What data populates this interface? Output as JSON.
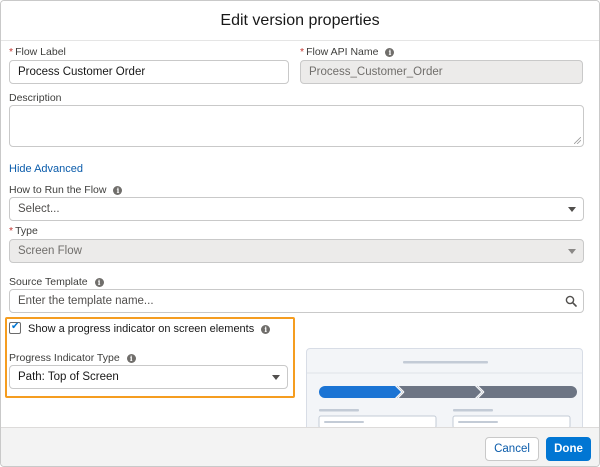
{
  "modal": {
    "title": "Edit version properties"
  },
  "fields": {
    "flow_label": {
      "label": "Flow Label",
      "value": "Process Customer Order",
      "required": "*"
    },
    "flow_api_name": {
      "label": "Flow API Name",
      "value": "Process_Customer_Order",
      "required": "*"
    },
    "description": {
      "label": "Description",
      "value": ""
    },
    "hide_advanced": "Hide Advanced",
    "how_to_run": {
      "label": "How to Run the Flow",
      "value": "Select..."
    },
    "type": {
      "label": "Type",
      "value": "Screen Flow",
      "required": "*"
    },
    "source_template": {
      "label": "Source Template",
      "placeholder": "Enter the template name..."
    },
    "progress_checkbox": {
      "label": "Show a progress indicator on screen elements",
      "checked": true
    },
    "progress_type": {
      "label": "Progress Indicator Type",
      "value": "Path: Top of Screen"
    }
  },
  "footer": {
    "cancel_label": "Cancel",
    "done_label": "Done"
  },
  "icons": {
    "info": "info-icon",
    "caret": "chevron-down-icon",
    "search": "search-icon",
    "check": "check-icon"
  },
  "colors": {
    "accent": "#0176d3",
    "highlight": "#f59d20",
    "required": "#c23934",
    "link": "#0b5cab"
  }
}
